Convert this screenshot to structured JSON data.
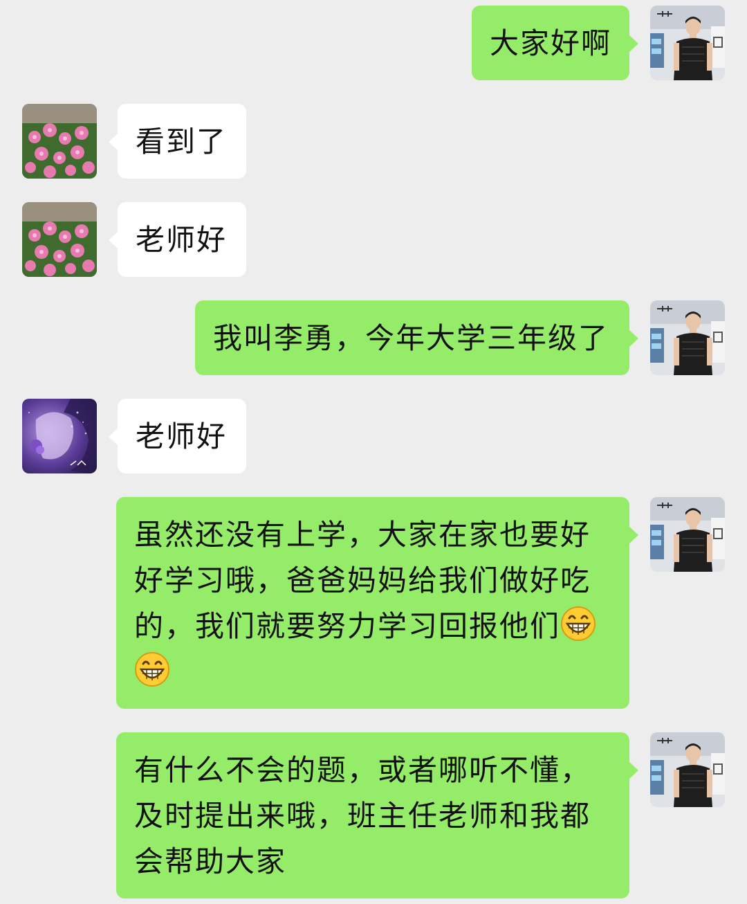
{
  "messages": [
    {
      "side": "out",
      "avatar": "man-portrait-avatar",
      "text": "大家好啊"
    },
    {
      "side": "in",
      "avatar": "pink-flowers-avatar",
      "text": "看到了"
    },
    {
      "side": "in",
      "avatar": "pink-flowers-avatar",
      "text": "老师好"
    },
    {
      "side": "out",
      "avatar": "man-portrait-avatar",
      "text": "我叫李勇，今年大学三年级了"
    },
    {
      "side": "in",
      "avatar": "purple-portrait-avatar",
      "text": "老师好"
    },
    {
      "side": "out",
      "avatar": "man-portrait-avatar",
      "text": "虽然还没有上学，大家在家也要好好学习哦，爸爸妈妈给我们做好吃的，我们就要努力学习回报他们",
      "emojis": [
        "grin-emoji",
        "grin-emoji"
      ]
    },
    {
      "side": "out",
      "avatar": "man-portrait-avatar",
      "text": "有什么不会的题，或者哪听不懂，及时提出来哦，班主任老师和我都会帮助大家"
    }
  ],
  "colors": {
    "background": "#ededed",
    "sent_bubble": "#95ec69",
    "received_bubble": "#ffffff",
    "text": "#111111"
  }
}
